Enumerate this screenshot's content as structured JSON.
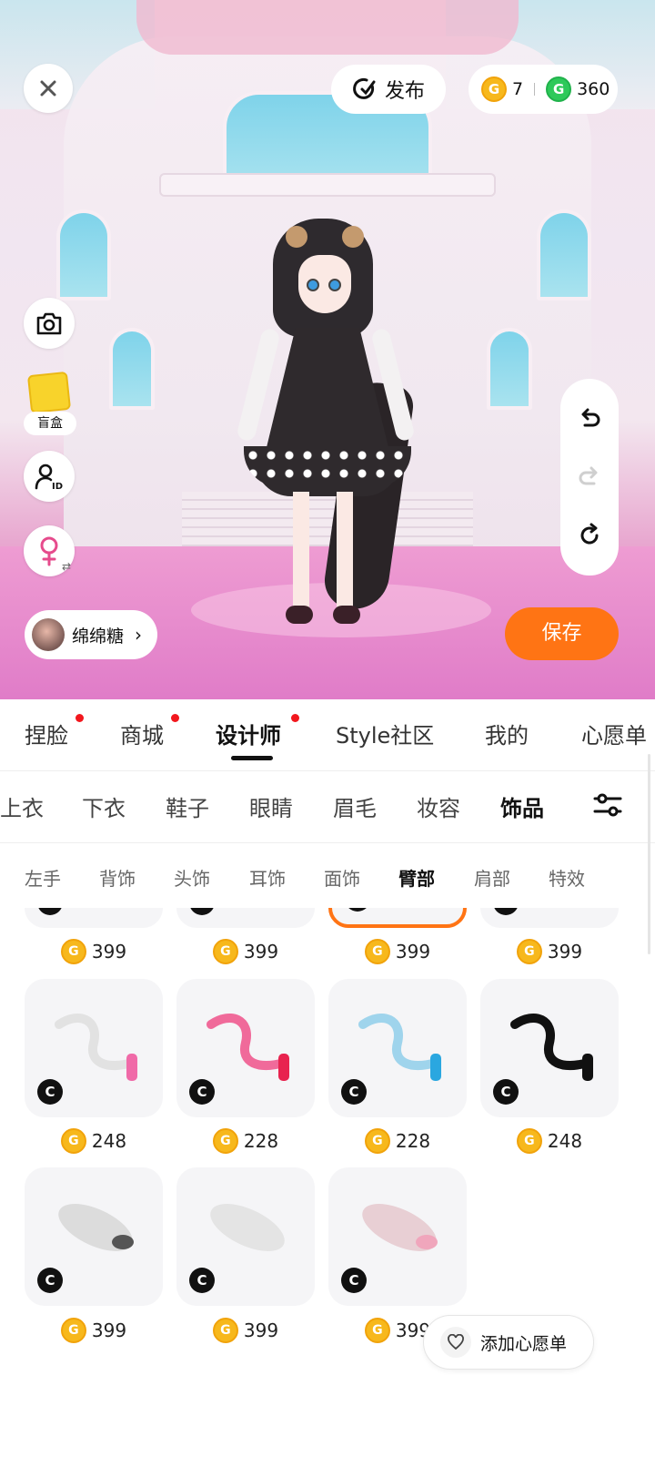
{
  "top_bar": {
    "close_icon": "close-icon",
    "publish_label": "发布",
    "gold_coins": "7",
    "green_coins": "360",
    "coin_glyph": "G"
  },
  "side_tools": {
    "blind_box_label": "盲盒",
    "id_label": "ID"
  },
  "profile": {
    "name": "绵绵糖"
  },
  "save_label": "保存",
  "main_tabs": [
    {
      "label": "捏脸",
      "dot": true
    },
    {
      "label": "商城",
      "dot": true
    },
    {
      "label": "设计师",
      "dot": true,
      "active": true
    },
    {
      "label": "Style社区"
    },
    {
      "label": "我的"
    },
    {
      "label": "心愿单"
    }
  ],
  "category_tabs": [
    {
      "label": "上衣"
    },
    {
      "label": "下衣"
    },
    {
      "label": "鞋子"
    },
    {
      "label": "眼睛"
    },
    {
      "label": "眉毛"
    },
    {
      "label": "妆容"
    },
    {
      "label": "饰品",
      "active": true
    }
  ],
  "sub_tabs": [
    {
      "label": "左手"
    },
    {
      "label": "背饰"
    },
    {
      "label": "头饰"
    },
    {
      "label": "耳饰"
    },
    {
      "label": "面饰"
    },
    {
      "label": "臂部",
      "active": true
    },
    {
      "label": "肩部"
    },
    {
      "label": "特效"
    }
  ],
  "items": [
    {
      "price": "399",
      "badge": "C",
      "partial": true
    },
    {
      "price": "399",
      "badge": "C",
      "partial": true
    },
    {
      "price": "399",
      "badge": "C",
      "partial": true,
      "selected": true
    },
    {
      "price": "399",
      "badge": "C",
      "partial": true
    },
    {
      "price": "248",
      "badge": "C",
      "thumb": "white-tail-pink-bow",
      "color": "#e7e7e7",
      "accent": "#f06aa8"
    },
    {
      "price": "228",
      "badge": "C",
      "thumb": "pink-tail-bow",
      "color": "#f06a9a",
      "accent": "#e8234f"
    },
    {
      "price": "228",
      "badge": "C",
      "thumb": "blue-white-tail-bow",
      "color": "#9fd4ec",
      "accent": "#2aa7e0"
    },
    {
      "price": "248",
      "badge": "C",
      "thumb": "black-tail-bow",
      "color": "#111111",
      "accent": "#111111"
    },
    {
      "price": "399",
      "badge": "C",
      "thumb": "fluffy-white-tail",
      "color": "#dcdcdc"
    },
    {
      "price": "399",
      "badge": "C",
      "thumb": "fluffy-white-tail",
      "color": "#e4e4e4"
    },
    {
      "price": "399",
      "badge": "C",
      "thumb": "fluffy-pink-tip-tail",
      "color": "#e8cfd4"
    }
  ],
  "wishlist_button": "添加心愿单",
  "colors": {
    "accent_orange": "#ff7414",
    "red_dot": "#f2171d",
    "gold_coin": "#f7b81c",
    "green_coin": "#2ec95a"
  }
}
